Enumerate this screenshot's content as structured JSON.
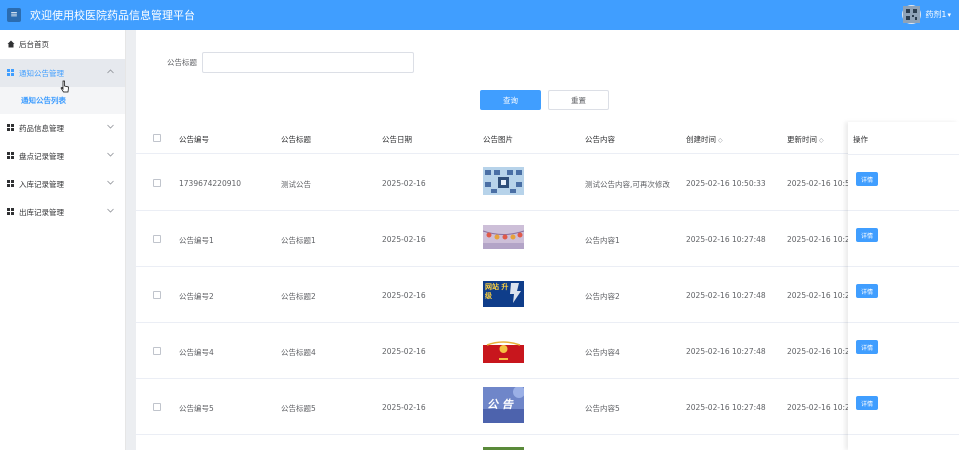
{
  "header": {
    "menu_icon": "≡",
    "title": "欢迎使用校医院药品信息管理平台",
    "username": "药剂1",
    "caret": "▾"
  },
  "sidebar": {
    "items": [
      {
        "label": "后台首页",
        "icon": "home-icon"
      },
      {
        "label": "通知公告管理",
        "icon": "grid-icon",
        "active": true,
        "expanded": true
      },
      {
        "label": "通知公告列表",
        "sub": true
      },
      {
        "label": "药品信息管理",
        "icon": "grid-icon"
      },
      {
        "label": "盘点记录管理",
        "icon": "grid-icon"
      },
      {
        "label": "入库记录管理",
        "icon": "grid-icon"
      },
      {
        "label": "出库记录管理",
        "icon": "grid-icon"
      }
    ]
  },
  "search": {
    "label": "公告标题",
    "value": "",
    "query_label": "查询",
    "reset_label": "重置"
  },
  "table": {
    "columns": [
      "公告编号",
      "公告标题",
      "公告日期",
      "公告图片",
      "公告内容",
      "创建时间",
      "更新时间",
      "操作"
    ],
    "rows": [
      {
        "code": "1739674220910",
        "title": "测试公告",
        "date": "2025-02-16",
        "image": "game-scene",
        "content": "测试公告内容,可再次修改",
        "created": "2025-02-16 10:50:33",
        "updated": "2025-02-16 10:50:",
        "action": "详情"
      },
      {
        "code": "公告编号1",
        "title": "公告标题1",
        "date": "2025-02-16",
        "image": "lantern-banner",
        "content": "公告内容1",
        "created": "2025-02-16 10:27:48",
        "updated": "2025-02-16 10:27:",
        "action": "详情"
      },
      {
        "code": "公告编号2",
        "title": "公告标题2",
        "date": "2025-02-16",
        "image": "upgrade-banner",
        "content": "公告内容2",
        "created": "2025-02-16 10:27:48",
        "updated": "2025-02-16 10:27:",
        "action": "详情",
        "image_text": "网站 升级"
      },
      {
        "code": "公告编号4",
        "title": "公告标题4",
        "date": "2025-02-16",
        "image": "red-emblem",
        "content": "公告内容4",
        "created": "2025-02-16 10:27:48",
        "updated": "2025-02-16 10:27:",
        "action": "详情"
      },
      {
        "code": "公告编号5",
        "title": "公告标题5",
        "date": "2025-02-16",
        "image": "notice-banner",
        "content": "公告内容5",
        "created": "2025-02-16 10:27:48",
        "updated": "2025-02-16 10:27:",
        "action": "详情",
        "image_text": "公 告"
      }
    ]
  },
  "colors": {
    "primary": "#409eff",
    "sidebar_active_bg": "#e6e9ee"
  }
}
